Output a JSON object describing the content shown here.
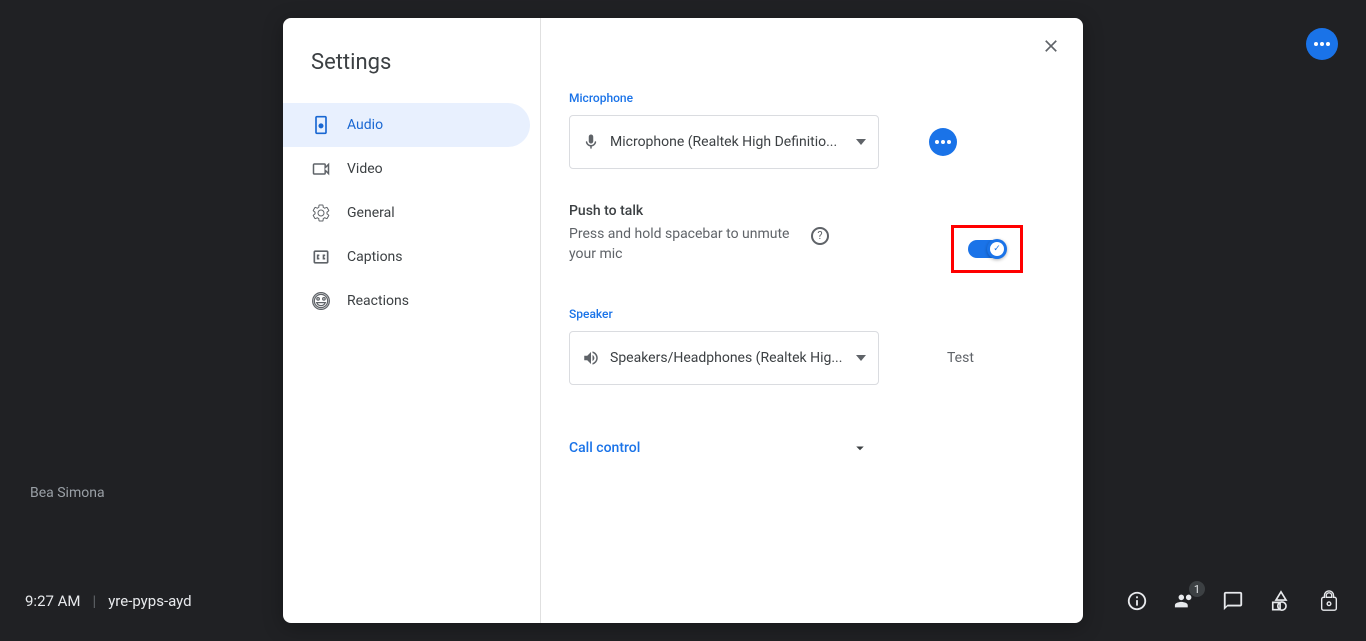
{
  "background": {
    "participant_name": "Bea Simona",
    "time": "9:27 AM",
    "meeting_code": "yre-pyps-ayd",
    "people_badge": "1"
  },
  "modal": {
    "title": "Settings",
    "nav": {
      "audio": "Audio",
      "video": "Video",
      "general": "General",
      "captions": "Captions",
      "reactions": "Reactions"
    },
    "sections": {
      "microphone_label": "Microphone",
      "microphone_value": "Microphone (Realtek High Definitio...",
      "push_title": "Push to talk",
      "push_desc": "Press and hold spacebar to unmute your mic",
      "speaker_label": "Speaker",
      "speaker_value": "Speakers/Headphones (Realtek Hig...",
      "test_label": "Test",
      "call_control": "Call control"
    }
  }
}
